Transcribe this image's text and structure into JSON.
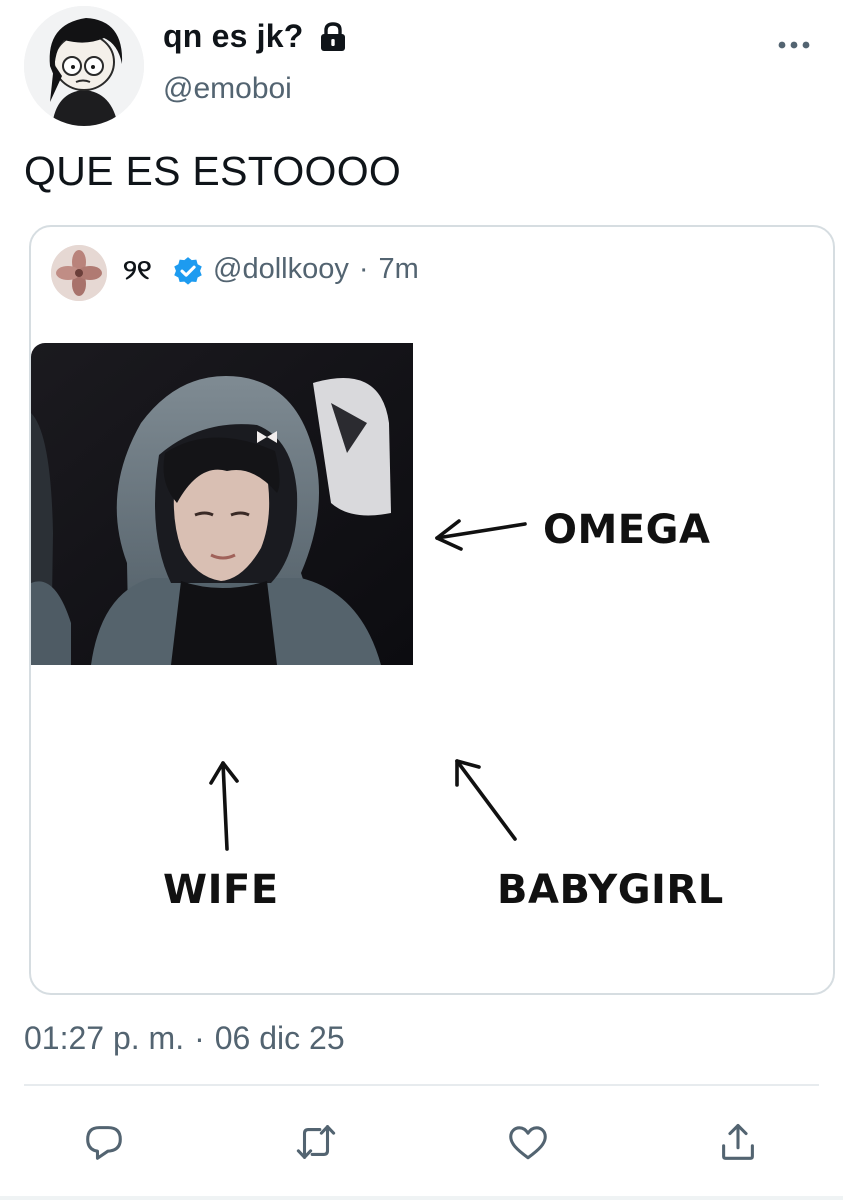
{
  "tweet": {
    "author": {
      "display_name": "qn es jk?",
      "handle": "@emoboi",
      "protected_icon": "lock-icon"
    },
    "text": "QUE ES ESTOOOO",
    "timestamp": {
      "time": "01:27 p. m.",
      "separator": "·",
      "date": "06 dic 25"
    }
  },
  "quoted_tweet": {
    "display_name": "୨୧",
    "verified_icon": "verified-badge-icon",
    "handle": "@dollkooy",
    "separator": "·",
    "time_ago": "7m",
    "media": {
      "labels": {
        "omega": "OMEGA",
        "wife": "WIFE",
        "babygirl": "BABYGIRL"
      }
    }
  },
  "actions": [
    {
      "name": "reply",
      "icon": "reply-icon"
    },
    {
      "name": "retweet",
      "icon": "retweet-icon"
    },
    {
      "name": "like",
      "icon": "heart-icon"
    },
    {
      "name": "share",
      "icon": "share-icon"
    }
  ],
  "colors": {
    "text_primary": "#0f1419",
    "text_secondary": "#536471",
    "verified_blue": "#1d9bf0",
    "border": "#d6dde1"
  }
}
